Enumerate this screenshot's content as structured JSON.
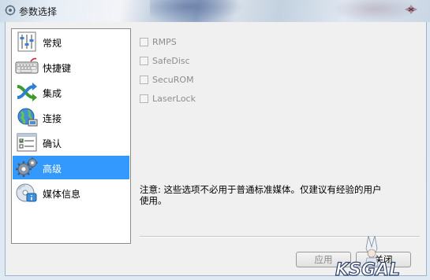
{
  "window": {
    "title": "参数选择"
  },
  "sidebar": {
    "items": [
      {
        "label": "常规",
        "icon": "sliders-icon"
      },
      {
        "label": "快捷键",
        "icon": "keyboard-icon"
      },
      {
        "label": "集成",
        "icon": "shuffle-icon"
      },
      {
        "label": "连接",
        "icon": "globe-network-icon"
      },
      {
        "label": "确认",
        "icon": "checklist-window-icon"
      },
      {
        "label": "高级",
        "icon": "gears-icon",
        "selected": true
      },
      {
        "label": "媒体信息",
        "icon": "disc-info-icon"
      }
    ]
  },
  "options": [
    {
      "label": "RMPS",
      "checked": false,
      "enabled": false
    },
    {
      "label": "SafeDisc",
      "checked": false,
      "enabled": false
    },
    {
      "label": "SecuROM",
      "checked": false,
      "enabled": false
    },
    {
      "label": "LaserLock",
      "checked": false,
      "enabled": false
    }
  ],
  "note": {
    "line1": "注意: 这些选项不必用于普通标准媒体。仅建议有经验的用户",
    "line2": "使用。"
  },
  "buttons": {
    "apply": "应用",
    "close": "关闭"
  },
  "watermark": {
    "text": "KSGAL"
  },
  "colors": {
    "selection": "#3399ff",
    "disabled_text": "#8d8d8d"
  }
}
